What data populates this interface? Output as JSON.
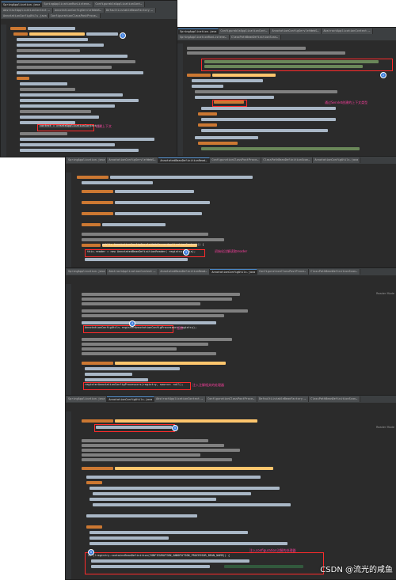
{
  "panels": [
    {
      "tabs": [
        "SpringApplication.java",
        "SpringApplicationRunListeners.java",
        "ConfigurableApplicationContext.java",
        "AbstractApplicationContext.java",
        "AnnotationConfigServletWebServerApplicationContext.java",
        "DefaultListableBeanFactory.java",
        "AnnotationConfigUtils.java",
        "ConfigurationClassPostProcessor.java"
      ],
      "active_tab": 0
    },
    {
      "tabs": [
        "SpringApplication.java",
        "ConfigurableApplicationContext.java",
        "AnnotationConfigServletWebServerApplicationContext.java",
        "AbstractApplicationContext.java",
        "SpringApplicationRunListeners.java",
        "ClassPathBeanDefinitionScanner.java"
      ],
      "active_tab": 0
    },
    {
      "tabs": [
        "SpringApplication.java",
        "AnnotationConfigServletWebServerApplicationContext.java",
        "AnnotatedBeanDefinitionReader.java",
        "ConfigurationClassPostProcessor.java",
        "ClassPathBeanDefinitionScanner.java",
        "AnnotationConfigUtils.java"
      ],
      "active_tab": 2
    },
    {
      "tabs": [
        "SpringApplication.java",
        "AbstractApplicationContext.java",
        "AnnotatedBeanDefinitionReader.java",
        "AnnotationConfigUtils.java",
        "ConfigurationClassPostProcessor.java",
        "ClassPathBeanDefinitionScanner.java"
      ],
      "active_tab": 3,
      "reader_mode": "Reader Mode"
    },
    {
      "tabs": [
        "SpringApplication.java",
        "AnnotationConfigUtils.java",
        "AbstractApplicationContext.java",
        "ConfigurationClassPostProcessor.java",
        "DefaultListableBeanFactory.java",
        "ClassPathBeanDefinitionScanner.java"
      ],
      "active_tab": 1,
      "reader_mode": "Reader Mode"
    }
  ],
  "code": {
    "create_context": "context = createApplicationContext();",
    "default_constructor": "public AnnotationConfigServletWebServerApplicationContext() {",
    "reader_init": "this.reader = new AnnotatedBeanDefinitionReader( registry: this);",
    "register_processors": "AnnotationConfigUtils.registerAnnotationConfigProcessors(registry);",
    "register_processors_call": "registerAnnotationConfigProcessors(registry, source: null);",
    "config_processor_check": "if (!registry.containsBeanDefinition(CONFIGURATION_ANNOTATION_PROCESSOR_BEAN_NAME)) {"
  },
  "annotations": {
    "create_context": "创建上下文",
    "servlet_web_type": "通过Servlet创建的上下文类型",
    "reader_init": "初始化注解读取reader",
    "register_processors": "注册",
    "register_processors_call": "注入注解相关的处理器",
    "config_processor": "注入configuration注解的处理器"
  },
  "markers": [
    "1",
    "2",
    "3",
    "4",
    "5",
    "6"
  ],
  "watermark": "CSDN @流光的咸鱼",
  "colors": {
    "editor_bg": "#2b2b2b",
    "tab_bg": "#3c3f41",
    "highlight_box": "#ff2b2b",
    "annotation_text": "#ff3fa0",
    "arrow": "#f0a030",
    "marker": "#3f7fdc"
  }
}
